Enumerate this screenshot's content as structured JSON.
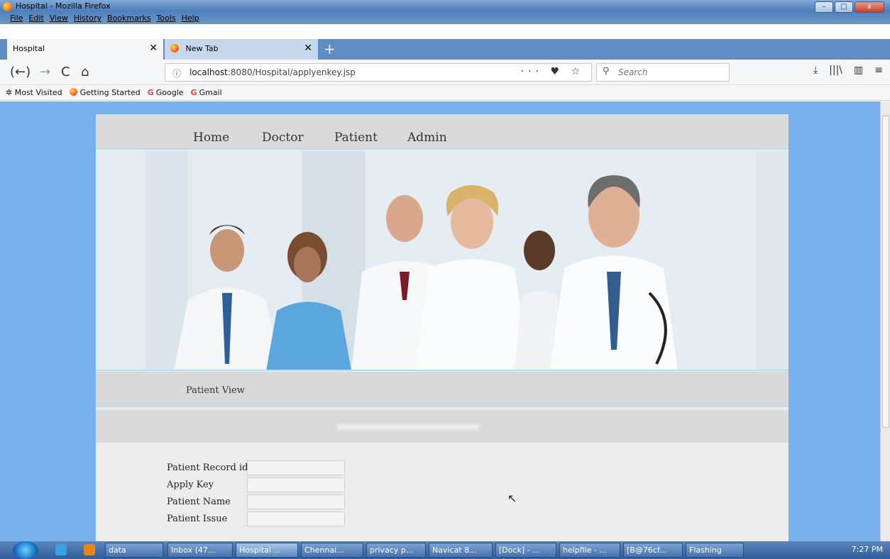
{
  "window": {
    "title": "Hospital - Mozilla Firefox",
    "min": "–",
    "max": "□",
    "close": "x"
  },
  "menu": [
    "File",
    "Edit",
    "View",
    "History",
    "Bookmarks",
    "Tools",
    "Help"
  ],
  "tabs": [
    {
      "label": "Hospital",
      "close": "✕"
    },
    {
      "label": "New Tab",
      "close": "✕"
    }
  ],
  "newtab": "+",
  "nav": {
    "back": "(←)",
    "forward": "→",
    "reload": "C",
    "home": "⌂",
    "info": "ⓘ",
    "url_host": "localhost",
    "url_rest": ":8080/Hospital/applyenkey.jsp",
    "page_actions": "··· ♥ ☆",
    "search_placeholder": "Search",
    "right": [
      "⤓",
      "|||\\",
      "▥",
      "≡"
    ]
  },
  "bookmarks": [
    {
      "label": "Most Visited",
      "icon": "gear-icon"
    },
    {
      "label": "Getting Started",
      "icon": "firefox-icon"
    },
    {
      "label": "Google",
      "icon": "google-icon"
    },
    {
      "label": "Gmail",
      "icon": "google-icon"
    }
  ],
  "site": {
    "nav": [
      "Home",
      "Doctor",
      "Patient",
      "Admin"
    ],
    "section_title": "Patient View",
    "form": [
      {
        "label": "Patient Record id",
        "value": ""
      },
      {
        "label": "Apply Key",
        "value": ""
      },
      {
        "label": "Patient Name",
        "value": ""
      },
      {
        "label": "Patient Issue",
        "value": ""
      }
    ]
  },
  "taskbar": {
    "items": [
      "data",
      "Inbox (47...",
      "Hospital ...",
      "Chennai...",
      "privacy p...",
      "Navicat 8...",
      "[Dock] - ...",
      "helpfile - ...",
      "[B@76cf...",
      "Flashing"
    ],
    "clock": "7:27 PM"
  },
  "colors": {
    "page_bg": "#78b0ee",
    "accent_line": "#b8dcf0"
  }
}
